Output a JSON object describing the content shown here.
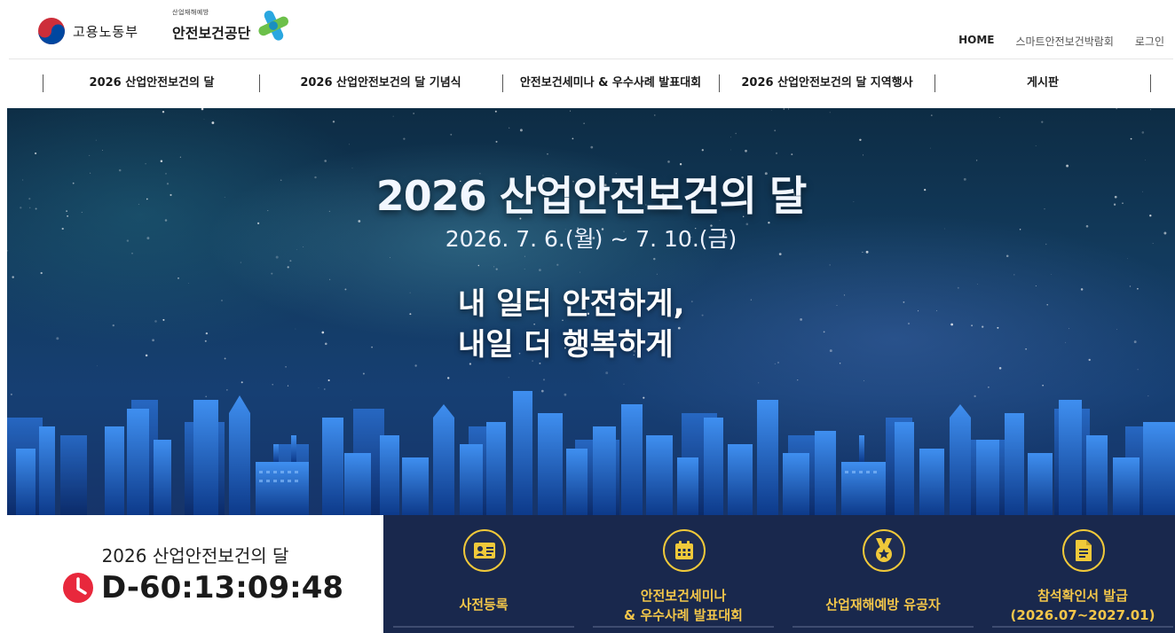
{
  "header": {
    "ministry_name": "고용노동부",
    "agency_subtitle": "산업재해예방",
    "agency_name": "안전보건공단",
    "util_links": [
      "HOME",
      "스마트안전보건박람회",
      "로그인"
    ]
  },
  "gnb": {
    "items": [
      "2026 산업안전보건의 달",
      "2026 산업안전보건의 달 기념식",
      "안전보건세미나 & 우수사례 발표대회",
      "2026 산업안전보건의 달 지역행사",
      "게시판"
    ]
  },
  "hero": {
    "title": "2026 산업안전보건의 달",
    "date": "2026. 7. 6.(월) ~ 7. 10.(금)",
    "slogan_line1": "내 일터 안전하게,",
    "slogan_line2": "내일 더 행복하게"
  },
  "countdown": {
    "label": "2026 산업안전보건의 달",
    "value": "D-60:13:09:48",
    "icon": "clock-icon"
  },
  "quick_menu": [
    {
      "line1": "사전등록",
      "line2": "",
      "icon": "id-card-icon"
    },
    {
      "line1": "안전보건세미나",
      "line2": "& 우수사례 발표대회",
      "icon": "calendar-icon"
    },
    {
      "line1": "산업재해예방 유공자",
      "line2": "",
      "icon": "medal-icon"
    },
    {
      "line1": "참석확인서 발급",
      "line2": "(2026.07~2027.01)",
      "icon": "document-icon"
    }
  ],
  "colors": {
    "navy": "#19284d",
    "gold": "#f0c93a",
    "countdown_red": "#e8283c",
    "kosha_green": "#6cc04a",
    "kosha_blue": "#2aa7e0"
  }
}
